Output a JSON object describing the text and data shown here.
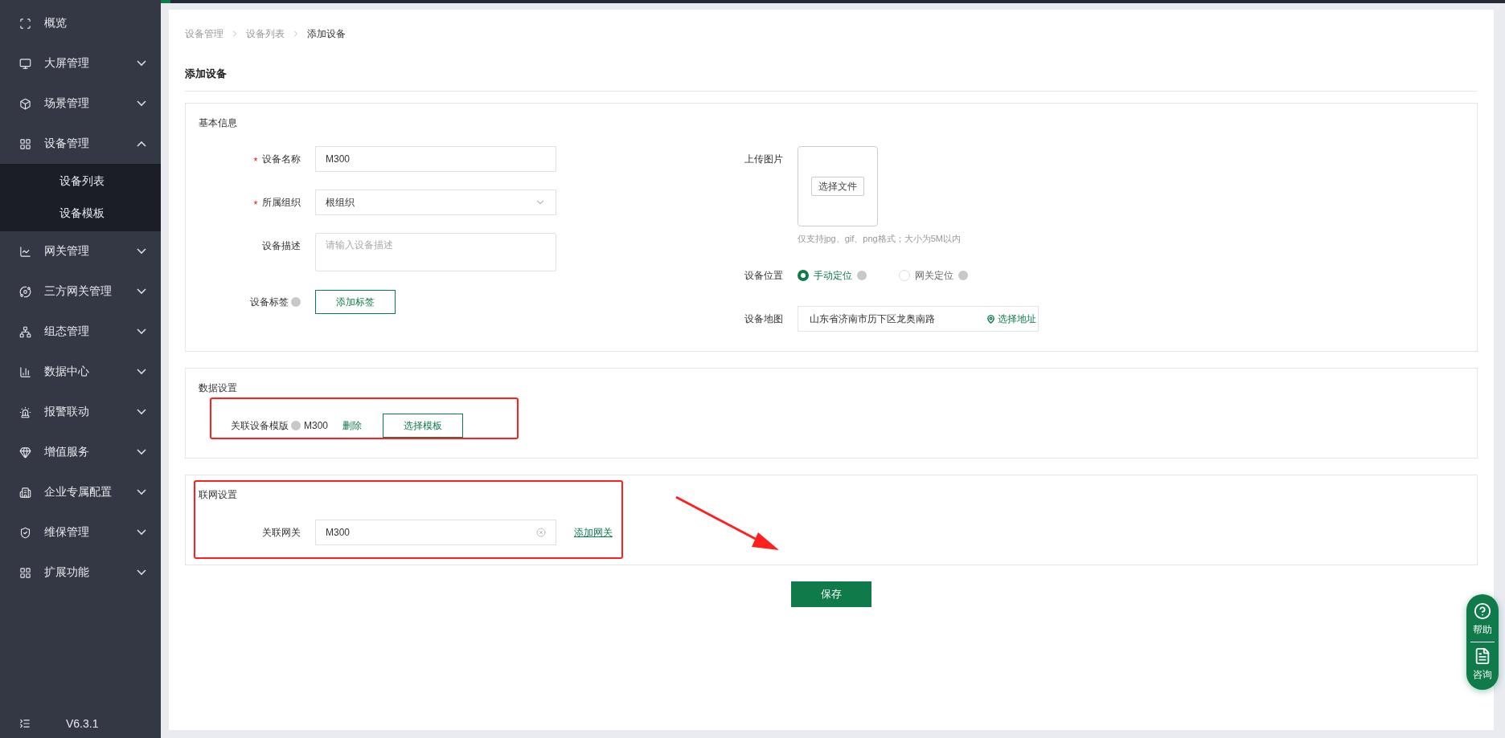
{
  "sidebar": {
    "items": [
      {
        "label": "概览",
        "kind": "link"
      },
      {
        "label": "大屏管理",
        "kind": "group",
        "expanded": false
      },
      {
        "label": "场景管理",
        "kind": "group",
        "expanded": false
      },
      {
        "label": "设备管理",
        "kind": "group",
        "expanded": true,
        "children": [
          {
            "label": "设备列表"
          },
          {
            "label": "设备模板"
          }
        ]
      },
      {
        "label": "网关管理",
        "kind": "group",
        "expanded": false
      },
      {
        "label": "三方网关管理",
        "kind": "group",
        "expanded": false
      },
      {
        "label": "组态管理",
        "kind": "group",
        "expanded": false
      },
      {
        "label": "数据中心",
        "kind": "group",
        "expanded": false
      },
      {
        "label": "报警联动",
        "kind": "group",
        "expanded": false
      },
      {
        "label": "增值服务",
        "kind": "group",
        "expanded": false
      },
      {
        "label": "企业专属配置",
        "kind": "group",
        "expanded": false
      },
      {
        "label": "维保管理",
        "kind": "group",
        "expanded": false
      },
      {
        "label": "扩展功能",
        "kind": "group",
        "expanded": false
      }
    ],
    "version": "V6.3.1"
  },
  "breadcrumb": [
    "设备管理",
    "设备列表",
    "添加设备"
  ],
  "page_title": "添加设备",
  "basic": {
    "title": "基本信息",
    "fields": [
      {
        "kind": "input",
        "label": "设备名称",
        "required": true,
        "help": false,
        "value": "M300"
      },
      {
        "kind": "select",
        "label": "所属组织",
        "required": true,
        "help": false,
        "value": "根组织"
      },
      {
        "kind": "textarea",
        "label": "设备描述",
        "required": false,
        "help": false,
        "placeholder": "请输入设备描述"
      },
      {
        "kind": "button",
        "label": "设备标签",
        "required": false,
        "help": true,
        "button": "添加标签"
      }
    ],
    "upload": {
      "label": "上传图片",
      "button": "选择文件",
      "hint": "仅支持jpg、gif、png格式；大小为5M以内"
    },
    "position": {
      "label": "设备位置",
      "options": [
        {
          "label": "手动定位",
          "selected": true
        },
        {
          "label": "网关定位",
          "selected": false
        }
      ]
    },
    "map": {
      "label": "设备地图",
      "value": "山东省济南市历下区龙奥南路",
      "action": "选择地址"
    }
  },
  "data_settings": {
    "title": "数据设置",
    "label": "关联设备模版",
    "value": "M300",
    "delete": "删除",
    "button": "选择模板"
  },
  "network_settings": {
    "title": "联网设置",
    "label": "关联网关",
    "value": "M300",
    "link": "添加网关"
  },
  "save": "保存",
  "help_widget": [
    {
      "label": "帮助"
    },
    {
      "label": "咨询"
    }
  ]
}
